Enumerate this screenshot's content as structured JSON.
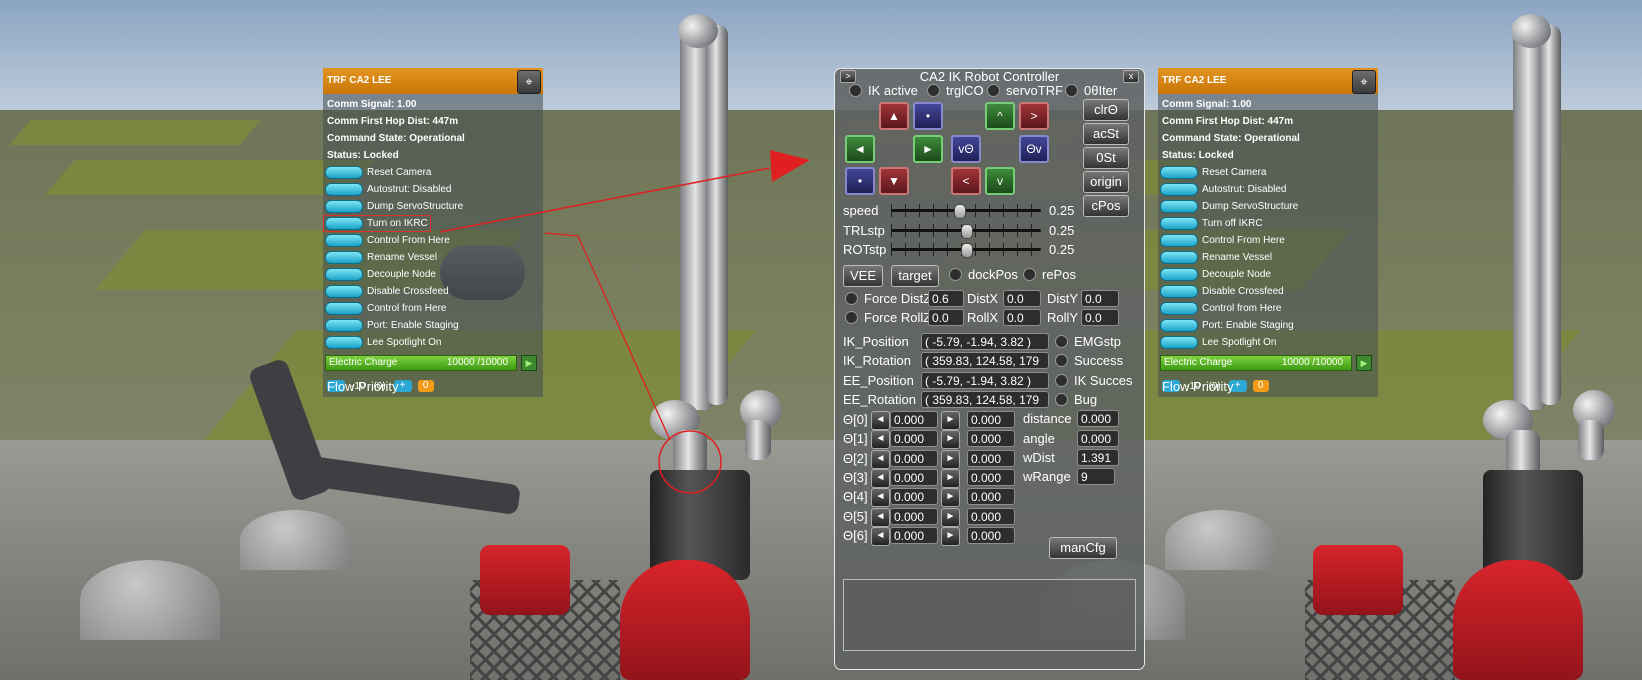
{
  "part_window": {
    "title": "TRF CA2 LEE",
    "pin_icon": "pin-icon",
    "info_lines": [
      "Comm Signal: 1.00",
      "Comm First Hop Dist: 447m",
      "Command State: Operational",
      "Status: Locked"
    ],
    "buttons_left": [
      "Reset Camera",
      "Autostrut: Disabled",
      "Dump ServoStructure",
      "Turn on IKRC",
      "Control From Here",
      "Rename Vessel",
      "Decouple Node",
      "Disable Crossfeed",
      "Control from Here",
      "Port: Enable Staging",
      "Lee Spotlight On"
    ],
    "buttons_right": [
      "Reset Camera",
      "Autostrut: Disabled",
      "Dump ServoStructure",
      "Turn off IKRC",
      "Control From Here",
      "Rename Vessel",
      "Decouple Node",
      "Disable Crossfeed",
      "Control from Here",
      "Port: Enable Staging",
      "Lee Spotlight On"
    ],
    "resource": {
      "name": "Electric Charge",
      "value": "10000 /10000",
      "fill_fraction": 1.0
    },
    "flow": {
      "label": "Flow Priority",
      "minus": "-",
      "value": "-10",
      "paren": "(0)",
      "plus": "+",
      "orange": "0"
    }
  },
  "ik": {
    "title": "CA2 IK Robot Controller",
    "expand": ">",
    "close": "x",
    "toggles": [
      "IK active",
      "trglCO",
      "servoTRF",
      "0θIter"
    ],
    "pad_labels": {
      "up": "▲",
      "dot1": "•",
      "caret": "^",
      "gt": ">",
      "left": "◄",
      "right": "►",
      "vtheta": "vΘ",
      "thetav": "Θv",
      "dot2": "•",
      "down": "▼",
      "lt": "<",
      "v": "v"
    },
    "side_buttons": [
      "clrΘ",
      "acSt",
      "0St",
      "origin",
      "cPos"
    ],
    "sliders": [
      {
        "label": "speed",
        "value": "0.25",
        "fraction": 0.45
      },
      {
        "label": "TRLstp",
        "value": "0.25",
        "fraction": 0.5
      },
      {
        "label": "ROTstp",
        "value": "0.25",
        "fraction": 0.5
      }
    ],
    "vee": "VEE",
    "target": "target",
    "dockPos": "dockPos",
    "rePos": "rePos",
    "force_distz": "Force DistZ",
    "distz": "0.6",
    "distx_l": "DistX",
    "distx": "0.0",
    "disty_l": "DistY",
    "disty": "0.0",
    "force_rollz": "Force RollZ",
    "rollz": "0.0",
    "rollx_l": "RollX",
    "rollx": "0.0",
    "rolly_l": "RollY",
    "rolly": "0.0",
    "ik_position_l": "IK_Position",
    "ik_position": "( -5.79, -1.94, 3.82 )",
    "ik_rotation_l": "IK_Rotation",
    "ik_rotation": "( 359.83, 124.58, 179",
    "ee_position_l": "EE_Position",
    "ee_position": "( -5.79, -1.94, 3.82 )",
    "ee_rotation_l": "EE_Rotation",
    "ee_rotation": "( 359.83, 124.58, 179",
    "emgstp": "EMGstp",
    "success": "Success",
    "ik_succes": "IK Succes",
    "bug": "Bug",
    "thetas": [
      {
        "label": "Θ[0]",
        "v1": "0.000",
        "v2": "0.000"
      },
      {
        "label": "Θ[1]",
        "v1": "0.000",
        "v2": "0.000"
      },
      {
        "label": "Θ[2]",
        "v1": "0.000",
        "v2": "0.000"
      },
      {
        "label": "Θ[3]",
        "v1": "0.000",
        "v2": "0.000"
      },
      {
        "label": "Θ[4]",
        "v1": "0.000",
        "v2": "0.000"
      },
      {
        "label": "Θ[5]",
        "v1": "0.000",
        "v2": "0.000"
      },
      {
        "label": "Θ[6]",
        "v1": "0.000",
        "v2": "0.000"
      }
    ],
    "distance_l": "distance",
    "distance": "0.000",
    "angle_l": "angle",
    "angle": "0.000",
    "wdist_l": "wDist",
    "wdist": "1.391",
    "wrange_l": "wRange",
    "wrange": "9",
    "mancfg": "manCfg",
    "arrow_left": "◄",
    "arrow_right": "►"
  },
  "annotation_color": "#e02020"
}
